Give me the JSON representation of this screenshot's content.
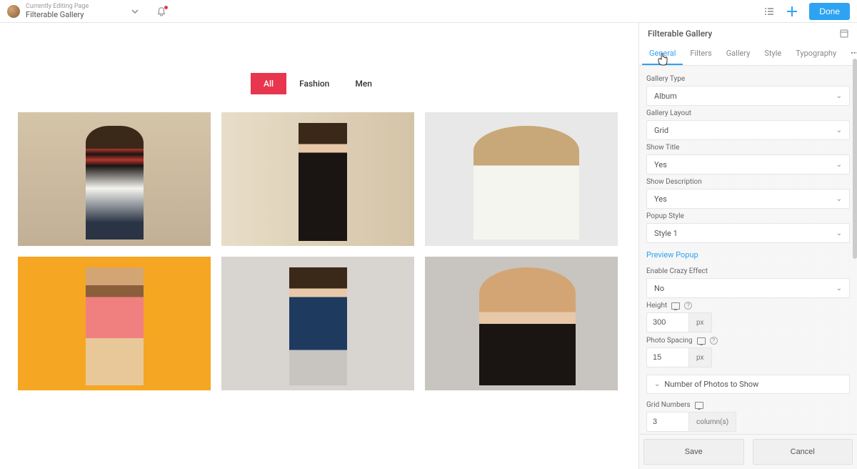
{
  "header": {
    "editing_label": "Currently Editing Page",
    "page_title": "Filterable Gallery",
    "done_label": "Done"
  },
  "filters": {
    "items": [
      {
        "label": "All",
        "active": true
      },
      {
        "label": "Fashion",
        "active": false
      },
      {
        "label": "Men",
        "active": false
      }
    ]
  },
  "panel": {
    "title": "Filterable Gallery",
    "tabs": [
      {
        "label": "General",
        "active": true
      },
      {
        "label": "Filters",
        "active": false
      },
      {
        "label": "Gallery",
        "active": false
      },
      {
        "label": "Style",
        "active": false
      },
      {
        "label": "Typography",
        "active": false
      }
    ],
    "fields": {
      "gallery_type": {
        "label": "Gallery Type",
        "value": "Album"
      },
      "gallery_layout": {
        "label": "Gallery Layout",
        "value": "Grid"
      },
      "show_title": {
        "label": "Show Title",
        "value": "Yes"
      },
      "show_description": {
        "label": "Show Description",
        "value": "Yes"
      },
      "popup_style": {
        "label": "Popup Style",
        "value": "Style 1"
      },
      "preview_popup": {
        "label": "Preview Popup"
      },
      "enable_crazy_effect": {
        "label": "Enable Crazy Effect",
        "value": "No"
      },
      "height": {
        "label": "Height",
        "value": "300",
        "unit": "px"
      },
      "photo_spacing": {
        "label": "Photo Spacing",
        "value": "15",
        "unit": "px"
      },
      "number_photos_section": "Number of Photos to Show",
      "grid_numbers": {
        "label": "Grid Numbers",
        "value": "3",
        "unit": "column(s)"
      }
    },
    "footer": {
      "save": "Save",
      "cancel": "Cancel"
    }
  }
}
